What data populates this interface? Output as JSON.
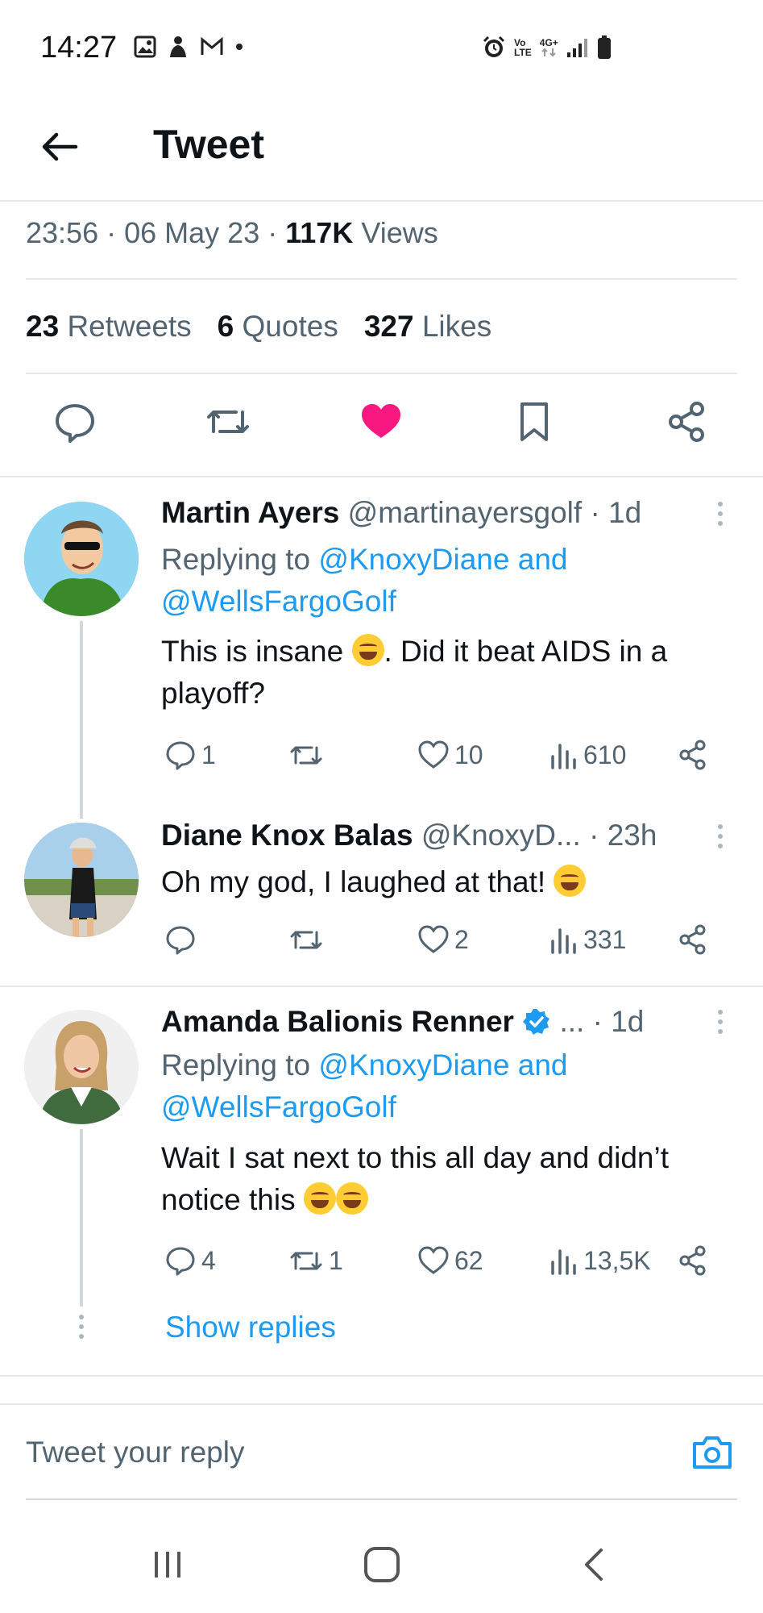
{
  "status_bar": {
    "time": "14:27",
    "net_vo": "Vo",
    "net_lte": "LTE",
    "net_4g": "4G+",
    "left_icons": [
      "image-icon",
      "person-icon",
      "mail-icon",
      "dot-icon"
    ],
    "right_icons": [
      "alarm-icon",
      "volte-icon",
      "network-4g-icon",
      "signal-icon",
      "battery-icon"
    ]
  },
  "header": {
    "title": "Tweet"
  },
  "tweet_meta": {
    "time": "23:56",
    "date": "06 May 23",
    "views_count": "117K",
    "views_label": "Views"
  },
  "tweet_stats": {
    "retweets_count": "23",
    "retweets_label": "Retweets",
    "quotes_count": "6",
    "quotes_label": "Quotes",
    "likes_count": "327",
    "likes_label": "Likes"
  },
  "tweet_actions": [
    "reply-icon",
    "retweet-icon",
    "liked-heart-icon",
    "bookmark-icon",
    "share-icon"
  ],
  "replies": [
    {
      "name": "Martin Ayers",
      "handle": "@martinayersgolf",
      "time": "· 1d",
      "replying_prefix": "Replying to",
      "replying_user1": "@KnoxyDiane",
      "replying_and": "and",
      "replying_user2": "@WellsFargoGolf",
      "text_part1": "This is insane",
      "text_part2": ". Did it beat AIDS in a",
      "text_part3": "playoff?",
      "reply_count": "1",
      "retweet_count": "",
      "like_count": "10",
      "view_count": "610"
    },
    {
      "name": "Diane Knox Balas",
      "handle": "@KnoxyD...",
      "time": "· 23h",
      "text": "Oh my god, I laughed at that!",
      "reply_count": "",
      "retweet_count": "",
      "like_count": "2",
      "view_count": "331"
    },
    {
      "name": "Amanda Balionis Renner",
      "handle": "...",
      "time": "· 1d",
      "verified": true,
      "replying_prefix": "Replying to",
      "replying_user1": "@KnoxyDiane",
      "replying_and": "and",
      "replying_user2": "@WellsFargoGolf",
      "text_part1": "Wait I sat next to this all day and didn’t",
      "text_part2": "notice this",
      "reply_count": "4",
      "retweet_count": "1",
      "like_count": "62",
      "view_count": "13,5K"
    }
  ],
  "show_replies_label": "Show replies",
  "reply_box": {
    "placeholder": "Tweet your reply"
  },
  "nav_bar": [
    "recents-icon",
    "home-icon",
    "back-icon"
  ],
  "colors": {
    "accent": "#1d9bf0",
    "like": "#f91880",
    "muted": "#536471",
    "divider": "#e6e9ec"
  }
}
